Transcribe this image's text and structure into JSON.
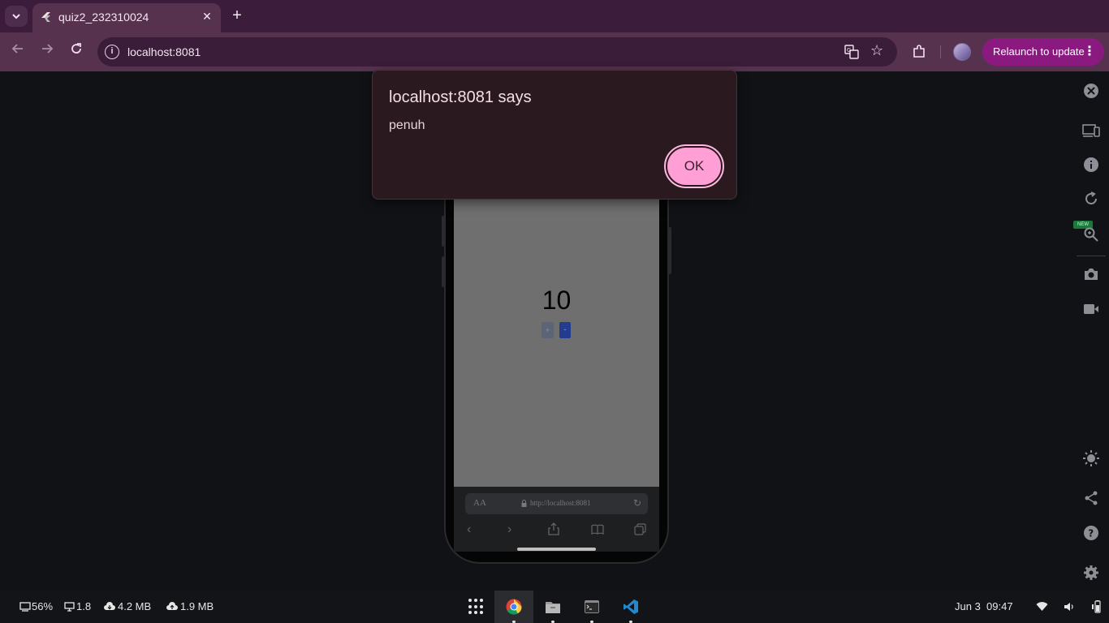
{
  "browser": {
    "tab_title": "quiz2_232310024",
    "url": "localhost:8081",
    "relaunch_label": "Relaunch to update"
  },
  "dialog": {
    "title": "localhost:8081 says",
    "message": "penuh",
    "ok_label": "OK"
  },
  "app": {
    "counter_value": "10",
    "plus_label": "+",
    "minus_label": "-"
  },
  "safari": {
    "aa_label": "AA",
    "address": "http://localhost:8081"
  },
  "devtools_rail": {
    "new_badge": "NEW",
    "icons": [
      "close-icon",
      "device-toggle-icon",
      "info-icon",
      "rotate-icon",
      "zoom-icon",
      "camera-icon",
      "video-icon",
      "brightness-icon",
      "share-icon",
      "help-icon",
      "settings-icon"
    ]
  },
  "shelf": {
    "battery": "56%",
    "load": "1.8",
    "download": "4.2 MB",
    "upload": "1.9 MB",
    "date": "Jun 3",
    "time": "09:47"
  },
  "colors": {
    "tab_strip": "#3b1d3b",
    "toolbar": "#57324f",
    "relaunch": "#8b1a80",
    "ok_button": "#ff9fd6",
    "dialog_bg": "#2a191f"
  }
}
